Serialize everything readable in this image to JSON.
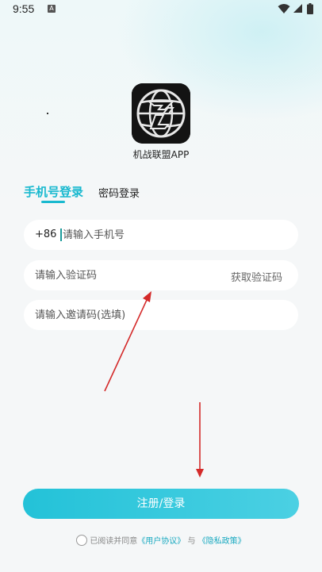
{
  "status_bar": {
    "time": "9:55",
    "notification_letter": "A"
  },
  "app": {
    "name": "机战联盟APP",
    "logo_icon": "globe-jl-logo"
  },
  "tabs": [
    {
      "label": "手机号登录",
      "active": true
    },
    {
      "label": "密码登录",
      "active": false
    }
  ],
  "form": {
    "country_code": "+86",
    "phone_placeholder": "请输入手机号",
    "code_placeholder": "请输入验证码",
    "get_code_label": "获取验证码",
    "invite_placeholder": "请输入邀请码(选填)"
  },
  "submit_label": "注册/登录",
  "agreement": {
    "prefix": "已阅读并同意",
    "user_agreement": "《用户协议》",
    "conjunction": "与",
    "privacy_policy": "《隐私政策》"
  },
  "colors": {
    "accent": "#19b9cf",
    "annotation_arrow": "#d42a2a"
  }
}
